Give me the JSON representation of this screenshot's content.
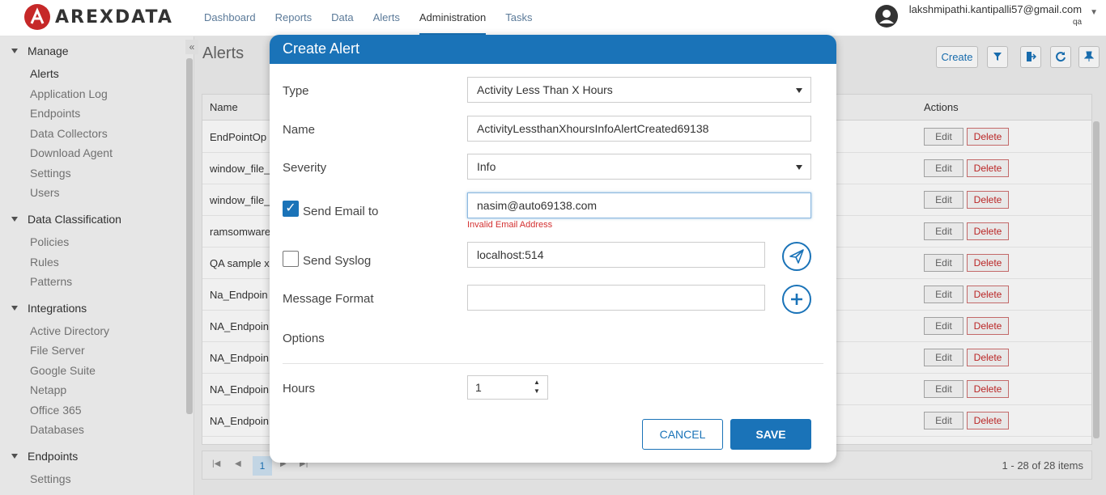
{
  "app": {
    "logo_text": "AREXDATA"
  },
  "nav": {
    "items": [
      "Dashboard",
      "Reports",
      "Data",
      "Alerts",
      "Administration",
      "Tasks"
    ],
    "active": "Administration"
  },
  "user": {
    "email": "lakshmipathi.kantipalli57@gmail.com",
    "role": "qa"
  },
  "sidebar": {
    "sections": [
      {
        "label": "Manage",
        "items": [
          "Alerts",
          "Application Log",
          "Endpoints",
          "Data Collectors",
          "Download Agent",
          "Settings",
          "Users"
        ]
      },
      {
        "label": "Data Classification",
        "items": [
          "Policies",
          "Rules",
          "Patterns"
        ]
      },
      {
        "label": "Integrations",
        "items": [
          "Active Directory",
          "File Server",
          "Google Suite",
          "Netapp",
          "Office 365",
          "Databases"
        ]
      },
      {
        "label": "Endpoints",
        "items": [
          "Settings"
        ]
      }
    ],
    "active_item": "Alerts"
  },
  "page": {
    "title": "Alerts",
    "create_label": "Create"
  },
  "grid": {
    "col_name": "Name",
    "col_actions": "Actions",
    "edit_label": "Edit",
    "delete_label": "Delete",
    "rows": [
      "EndPointOp",
      "window_file_",
      "window_file_",
      "ramsomware",
      "QA sample x",
      "Na_Endpoin",
      "NA_Endpoin",
      "NA_Endpoin",
      "NA_Endpoin",
      "NA_Endpoin"
    ]
  },
  "pager": {
    "current_page": "1",
    "summary": "1 - 28 of 28 items"
  },
  "modal": {
    "title": "Create Alert",
    "type_label": "Type",
    "type_value": "Activity Less Than X Hours",
    "name_label": "Name",
    "name_value": "ActivityLessthanXhoursInfoAlertCreated69138",
    "severity_label": "Severity",
    "severity_value": "Info",
    "send_email_label": "Send Email to",
    "send_email_checked": true,
    "email_value": "nasim@auto69138.com",
    "email_error": "Invalid Email Address",
    "send_syslog_label": "Send Syslog",
    "send_syslog_checked": false,
    "syslog_value": "localhost:514",
    "message_format_label": "Message Format",
    "message_format_value": "",
    "options_label": "Options",
    "hours_label": "Hours",
    "hours_value": "1",
    "cancel_label": "CANCEL",
    "save_label": "SAVE"
  },
  "colors": {
    "primary": "#1a73b8",
    "error": "#d32f2f",
    "brand_red": "#c62828"
  }
}
